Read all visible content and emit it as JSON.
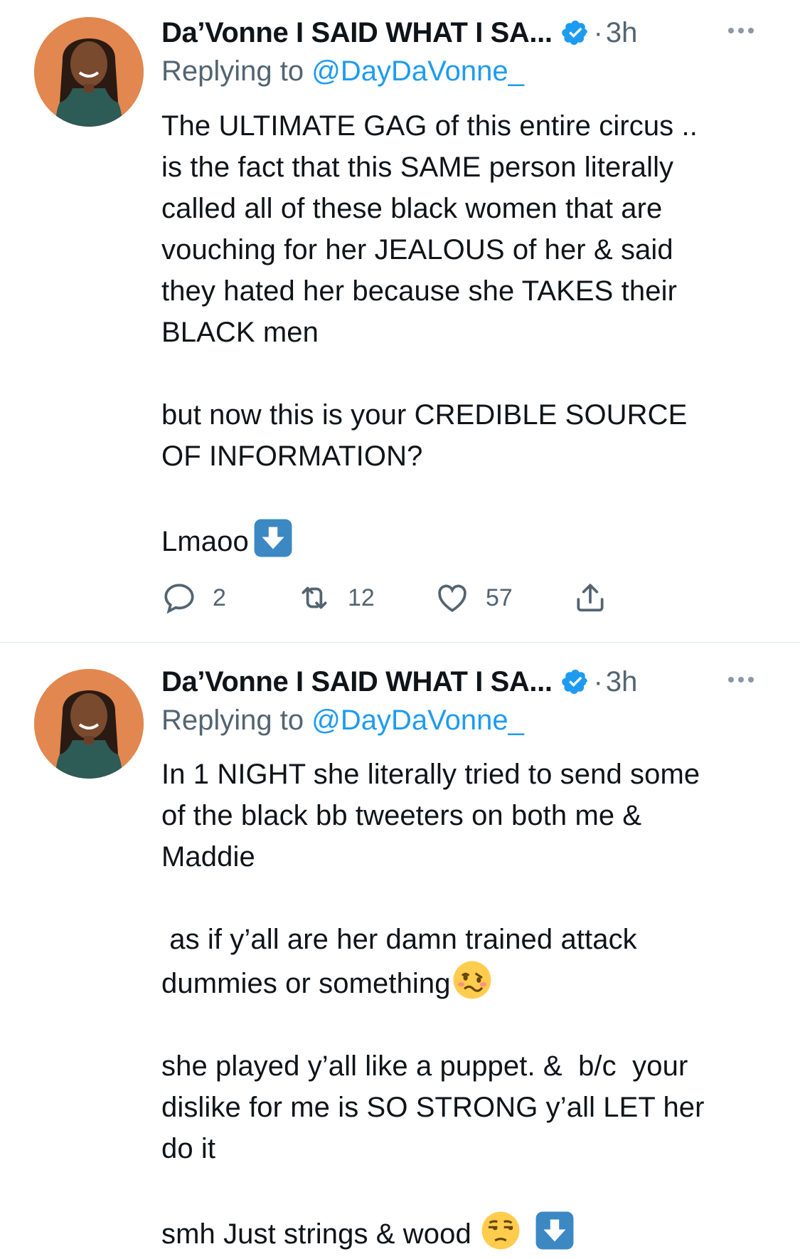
{
  "tweets": [
    {
      "author": "Da’Vonne I SAID WHAT I SA...",
      "separator": "·",
      "time": "3h",
      "replying_prefix": "Replying to ",
      "replying_handle": "@DayDaVonne_",
      "body_text": "The ULTIMATE GAG of this entire circus ..\nis the fact that this SAME person literally\ncalled all of these black women that are\nvouching for her JEALOUS of her & said\nthey hated her because she TAKES their\nBLACK men\n\nbut now this is your CREDIBLE SOURCE\nOF INFORMATION?\n\nLmaoo",
      "emoji_after": "down-arrow-emoji",
      "stats": {
        "replies": "2",
        "retweets": "12",
        "likes": "57"
      }
    },
    {
      "author": "Da’Vonne I SAID WHAT I SA...",
      "separator": "·",
      "time": "3h",
      "replying_prefix": "Replying to ",
      "replying_handle": "@DayDaVonne_",
      "body_1": "In 1 NIGHT she literally tried to send some\nof the black bb tweeters on both me &\nMaddie\n\n as if y’all are her damn trained attack\ndummies or something",
      "body_2": "\n\nshe played y’all like a puppet. &  b/c  your\ndislike for me is SO STRONG y’all LET her\ndo it\n\nsmh Just strings & wood ",
      "emoji_1": "woozy-face-emoji",
      "emoji_2": "unamused-face-emoji",
      "emoji_3": "down-arrow-emoji"
    }
  ],
  "colors": {
    "text": "#0f1419",
    "secondary": "#536471",
    "link": "#1d9bf0",
    "verified": "#1d9bf0",
    "divider": "#dfe3e6"
  },
  "icons": [
    "verified-badge-icon",
    "more-icon",
    "reply-icon",
    "retweet-icon",
    "like-icon",
    "share-icon"
  ]
}
